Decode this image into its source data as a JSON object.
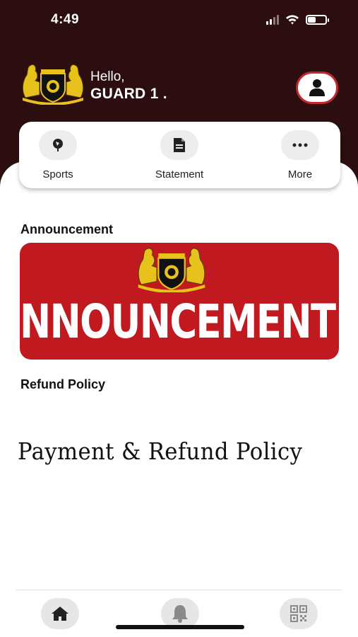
{
  "status_bar": {
    "time": "4:49",
    "signal_icon": "signal-icon",
    "wifi_icon": "wifi-icon",
    "battery_icon": "battery-icon"
  },
  "header": {
    "greeting": "Hello,",
    "user_name": "GUARD 1 .",
    "logo_icon": "club-crest-logo",
    "profile_icon": "user-icon"
  },
  "quick_menu": {
    "items": [
      {
        "label": "Sports",
        "icon": "sports-icon"
      },
      {
        "label": "Statement",
        "icon": "document-icon"
      },
      {
        "label": "More",
        "icon": "more-icon"
      }
    ]
  },
  "announcement": {
    "title": "Announcement",
    "banner_text": "NNOUNCEMENT"
  },
  "refund": {
    "title": "Refund Policy",
    "heading": "Payment & Refund Policy"
  },
  "bottom_nav": {
    "items": [
      {
        "icon": "home-icon"
      },
      {
        "icon": "bell-icon"
      },
      {
        "icon": "qr-code-icon"
      }
    ]
  },
  "colors": {
    "header_bg": "#2d0e10",
    "accent_red": "#c0191f",
    "crest_gold": "#e8c21c"
  }
}
